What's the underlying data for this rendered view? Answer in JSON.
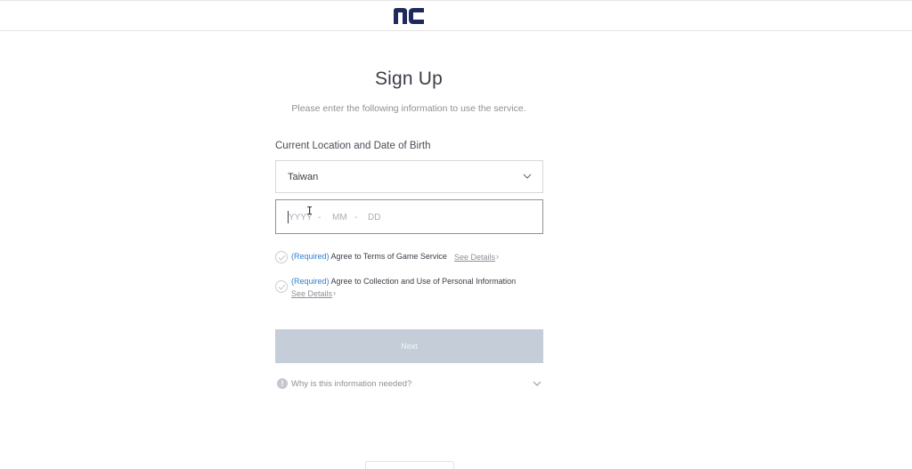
{
  "header": {
    "logo": "nc"
  },
  "title": "Sign Up",
  "subtitle": "Please enter the following information to use the service.",
  "section_label": "Current Location and Date of Birth",
  "location_select": {
    "value": "Taiwan"
  },
  "date_field": {
    "year_placeholder": "YYYY",
    "sep1": "-",
    "month_placeholder": "MM",
    "sep2": "-",
    "day_placeholder": "DD"
  },
  "agreements": [
    {
      "required_label": "(Required)",
      "text": "Agree to Terms of Game Service",
      "details": "See Details"
    },
    {
      "required_label": "(Required)",
      "text": "Agree to Collection and Use of Personal Information",
      "details": "See Details"
    }
  ],
  "next_label": "Next",
  "why": {
    "icon": "!",
    "text": "Why is this information needed?"
  },
  "colors": {
    "brand": "#1f2a5c",
    "required": "#2f7fd1",
    "button_disabled": "#c5ced8"
  }
}
